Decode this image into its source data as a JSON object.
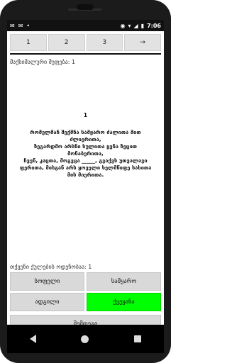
{
  "status": {
    "time": "7:06",
    "left_icons": [
      "message-icon",
      "message-icon",
      "notification-dot-icon"
    ],
    "right_icons": [
      "location-icon",
      "wifi-icon",
      "signal-icon",
      "battery-icon"
    ]
  },
  "tabs": [
    {
      "label": "1"
    },
    {
      "label": "2"
    },
    {
      "label": "3"
    },
    {
      "label": "→"
    }
  ],
  "max_score": "მაქსიმალური შეფება: 1",
  "poem": {
    "number": "1",
    "lines": [
      "რომელმან შექმნა სამყარო ძალითა მით",
      "ძლიერითა,",
      "ზეგარდმო არსნი სულითა ყვნა ზეცით",
      "მონაბერითა,",
      "ჩვენ, კაცთა, მოგვცა _____, გვაქვს უთვალავი",
      "ფერითა, მისგან არს ყოველი ხელმწიფე სახითა",
      "მის მიერითა."
    ]
  },
  "options_label": "თქვენი ქულების ოდენობაა: 1",
  "answers": [
    {
      "label": "სოფელი",
      "correct": false
    },
    {
      "label": "სამყარო",
      "correct": false
    },
    {
      "label": "ადგილი",
      "correct": false
    },
    {
      "label": "ქვეყანა",
      "correct": true
    }
  ],
  "check_label": "შემდეგი",
  "colors": {
    "correct": "#00ff00",
    "button_bg": "#d9d9d9",
    "tab_bg": "#e2e2e2"
  }
}
